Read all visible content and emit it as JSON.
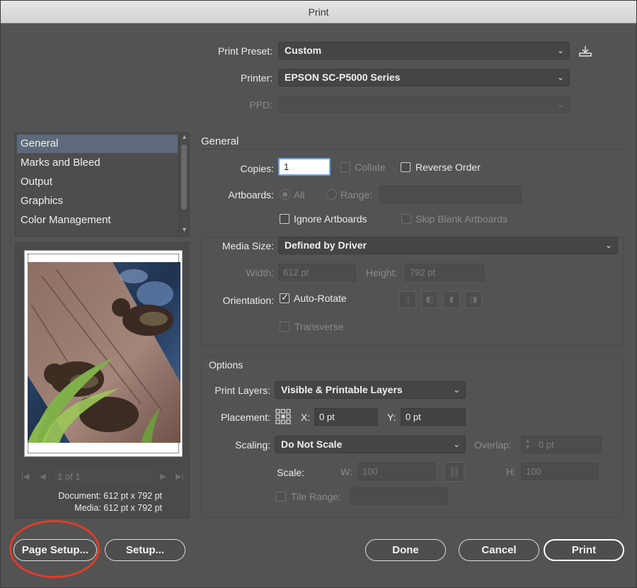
{
  "window": {
    "title": "Print"
  },
  "preset": {
    "label": "Print Preset:",
    "value": "Custom"
  },
  "printer": {
    "label": "Printer:",
    "value": "EPSON SC-P5000 Series"
  },
  "ppd": {
    "label": "PPD:",
    "value": ""
  },
  "sidebar": {
    "items": [
      {
        "label": "General"
      },
      {
        "label": "Marks and Bleed"
      },
      {
        "label": "Output"
      },
      {
        "label": "Graphics"
      },
      {
        "label": "Color Management"
      }
    ]
  },
  "preview": {
    "page_value": "1 of 1",
    "document_label": "Document: 612 pt x 792 pt",
    "media_label": "Media: 612 pt x 792 pt"
  },
  "general": {
    "heading": "General",
    "copies_label": "Copies:",
    "copies_value": "1",
    "collate_label": "Collate",
    "reverse_label": "Reverse Order",
    "artboards_label": "Artboards:",
    "all_label": "All",
    "range_label": "Range:",
    "ignore_label": "Ignore Artboards",
    "skip_label": "Skip Blank Artboards"
  },
  "media": {
    "size_label": "Media Size:",
    "size_value": "Defined by Driver",
    "width_label": "Width:",
    "width_value": "612 pt",
    "height_label": "Height:",
    "height_value": "792 pt",
    "orientation_label": "Orientation:",
    "autorotate_label": "Auto-Rotate",
    "transverse_label": "Transverse"
  },
  "options": {
    "heading": "Options",
    "layers_label": "Print Layers:",
    "layers_value": "Visible & Printable Layers",
    "placement_label": "Placement:",
    "x_label": "X:",
    "x_value": "0 pt",
    "y_label": "Y:",
    "y_value": "0 pt",
    "scaling_label": "Scaling:",
    "scaling_value": "Do Not Scale",
    "overlap_label": "Overlap:",
    "overlap_value": "0 pt",
    "scale_label": "Scale:",
    "w_label": "W:",
    "w_value": "100",
    "h_label": "H:",
    "h_value": "100",
    "tile_label": "Tile Range:"
  },
  "buttons": {
    "page_setup": "Page Setup...",
    "setup": "Setup...",
    "done": "Done",
    "cancel": "Cancel",
    "print": "Print"
  },
  "colors": {
    "annotation_ring": "#e23b27",
    "selection": "#5e6a7c"
  }
}
